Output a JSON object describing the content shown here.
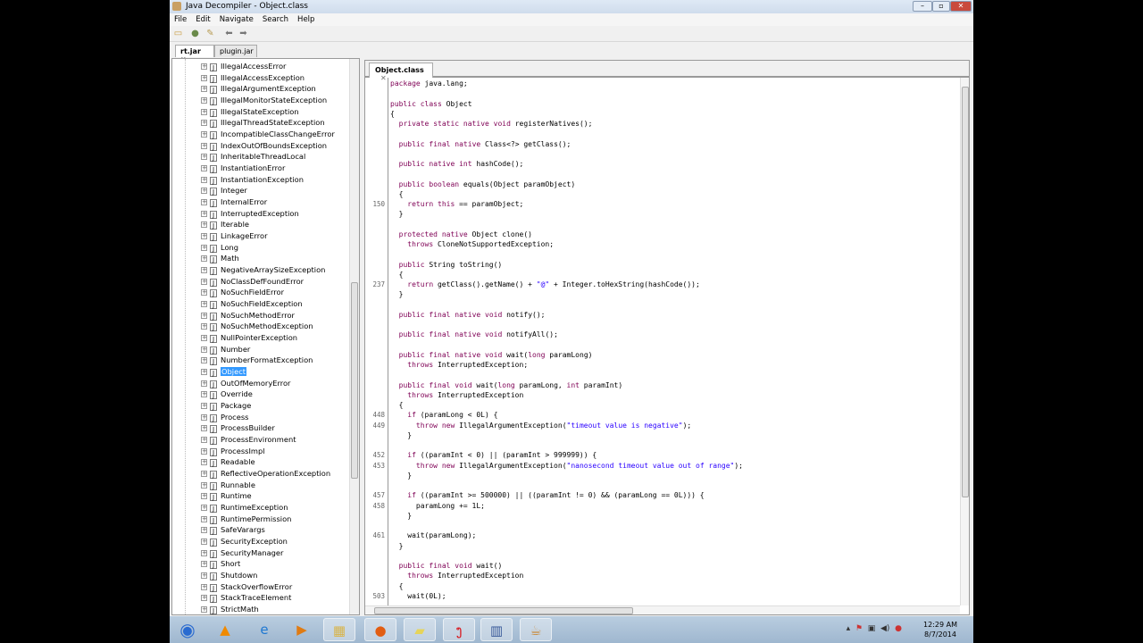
{
  "window": {
    "title": "Java Decompiler - Object.class"
  },
  "menu": [
    "File",
    "Edit",
    "Navigate",
    "Search",
    "Help"
  ],
  "jar_tabs": [
    {
      "label": "rt.jar",
      "active": true
    },
    {
      "label": "plugin.jar",
      "active": false
    }
  ],
  "tree": {
    "items": [
      "IllegalAccessError",
      "IllegalAccessException",
      "IllegalArgumentException",
      "IllegalMonitorStateException",
      "IllegalStateException",
      "IllegalThreadStateException",
      "IncompatibleClassChangeError",
      "IndexOutOfBoundsException",
      "InheritableThreadLocal",
      "InstantiationError",
      "InstantiationException",
      "Integer",
      "InternalError",
      "InterruptedException",
      "Iterable",
      "LinkageError",
      "Long",
      "Math",
      "NegativeArraySizeException",
      "NoClassDefFoundError",
      "NoSuchFieldError",
      "NoSuchFieldException",
      "NoSuchMethodError",
      "NoSuchMethodException",
      "NullPointerException",
      "Number",
      "NumberFormatException",
      "Object",
      "OutOfMemoryError",
      "Override",
      "Package",
      "Process",
      "ProcessBuilder",
      "ProcessEnvironment",
      "ProcessImpl",
      "Readable",
      "ReflectiveOperationException",
      "Runnable",
      "Runtime",
      "RuntimeException",
      "RuntimePermission",
      "SafeVarargs",
      "SecurityException",
      "SecurityManager",
      "Short",
      "Shutdown",
      "StackOverflowError",
      "StackTraceElement",
      "StrictMath"
    ],
    "selected": "Object"
  },
  "editor": {
    "tab": "Object.class",
    "lines": [
      {
        "t": "package java.lang;"
      },
      {
        "t": ""
      },
      {
        "t": "public class Object"
      },
      {
        "t": "{"
      },
      {
        "t": "  private static native void registerNatives();"
      },
      {
        "t": ""
      },
      {
        "t": "  public final native Class<?> getClass();"
      },
      {
        "t": ""
      },
      {
        "t": "  public native int hashCode();"
      },
      {
        "t": ""
      },
      {
        "t": "  public boolean equals(Object paramObject)"
      },
      {
        "t": "  {"
      },
      {
        "n": "150",
        "t": "    return this == paramObject;"
      },
      {
        "t": "  }"
      },
      {
        "t": ""
      },
      {
        "t": "  protected native Object clone()"
      },
      {
        "t": "    throws CloneNotSupportedException;"
      },
      {
        "t": ""
      },
      {
        "t": "  public String toString()"
      },
      {
        "t": "  {"
      },
      {
        "n": "237",
        "t": "    return getClass().getName() + \"@\" + Integer.toHexString(hashCode());"
      },
      {
        "t": "  }"
      },
      {
        "t": ""
      },
      {
        "t": "  public final native void notify();"
      },
      {
        "t": ""
      },
      {
        "t": "  public final native void notifyAll();"
      },
      {
        "t": ""
      },
      {
        "t": "  public final native void wait(long paramLong)"
      },
      {
        "t": "    throws InterruptedException;"
      },
      {
        "t": ""
      },
      {
        "t": "  public final void wait(long paramLong, int paramInt)"
      },
      {
        "t": "    throws InterruptedException"
      },
      {
        "t": "  {"
      },
      {
        "n": "448",
        "t": "    if (paramLong < 0L) {"
      },
      {
        "n": "449",
        "t": "      throw new IllegalArgumentException(\"timeout value is negative\");"
      },
      {
        "t": "    }"
      },
      {
        "t": ""
      },
      {
        "n": "452",
        "t": "    if ((paramInt < 0) || (paramInt > 999999)) {"
      },
      {
        "n": "453",
        "t": "      throw new IllegalArgumentException(\"nanosecond timeout value out of range\");"
      },
      {
        "t": "    }"
      },
      {
        "t": ""
      },
      {
        "n": "457",
        "t": "    if ((paramInt >= 500000) || ((paramInt != 0) && (paramLong == 0L))) {"
      },
      {
        "n": "458",
        "t": "      paramLong += 1L;"
      },
      {
        "t": "    }"
      },
      {
        "t": ""
      },
      {
        "n": "461",
        "t": "    wait(paramLong);"
      },
      {
        "t": "  }"
      },
      {
        "t": ""
      },
      {
        "t": "  public final void wait()"
      },
      {
        "t": "    throws InterruptedException"
      },
      {
        "t": "  {"
      },
      {
        "n": "503",
        "t": "    wait(0L);"
      }
    ]
  },
  "taskbar": {
    "time": "12:29 AM",
    "date": "8/7/2014"
  }
}
